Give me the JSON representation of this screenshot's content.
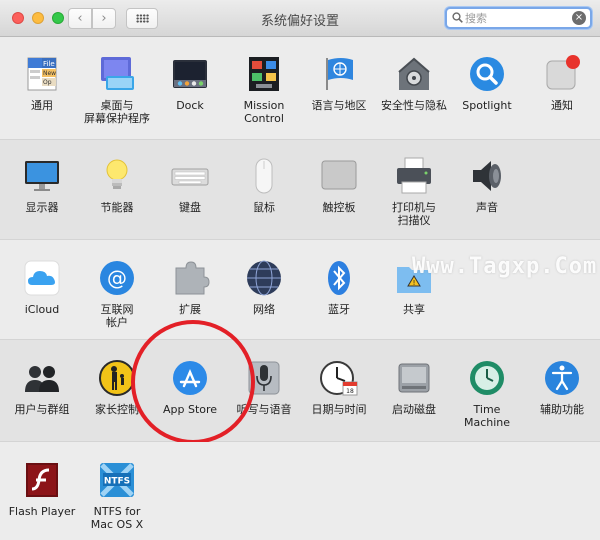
{
  "window": {
    "title": "系统偏好设置"
  },
  "toolbar": {
    "back_label": "‹",
    "forward_label": "›"
  },
  "search": {
    "placeholder": "搜索",
    "value": "",
    "clear_label": "×"
  },
  "watermark": "Www.Tagxp.Com",
  "sections": {
    "personal": [
      {
        "label": "通用",
        "icon": "general-icon"
      },
      {
        "label": "桌面与\n屏幕保护程序",
        "icon": "desktop-screensaver-icon"
      },
      {
        "label": "Dock",
        "icon": "dock-icon"
      },
      {
        "label": "Mission\nControl",
        "icon": "mission-control-icon"
      },
      {
        "label": "语言与地区",
        "icon": "language-region-icon"
      },
      {
        "label": "安全性与隐私",
        "icon": "security-privacy-icon"
      },
      {
        "label": "Spotlight",
        "icon": "spotlight-icon"
      },
      {
        "label": "通知",
        "icon": "notifications-icon"
      }
    ],
    "hardware": [
      {
        "label": "显示器",
        "icon": "displays-icon"
      },
      {
        "label": "节能器",
        "icon": "energy-saver-icon"
      },
      {
        "label": "键盘",
        "icon": "keyboard-icon"
      },
      {
        "label": "鼠标",
        "icon": "mouse-icon"
      },
      {
        "label": "触控板",
        "icon": "trackpad-icon"
      },
      {
        "label": "打印机与\n扫描仪",
        "icon": "printers-scanners-icon"
      },
      {
        "label": "声音",
        "icon": "sound-icon"
      }
    ],
    "internet": [
      {
        "label": "iCloud",
        "icon": "icloud-icon"
      },
      {
        "label": "互联网\n帐户",
        "icon": "internet-accounts-icon"
      },
      {
        "label": "扩展",
        "icon": "extensions-icon"
      },
      {
        "label": "网络",
        "icon": "network-icon"
      },
      {
        "label": "蓝牙",
        "icon": "bluetooth-icon"
      },
      {
        "label": "共享",
        "icon": "sharing-icon"
      }
    ],
    "system": [
      {
        "label": "用户与群组",
        "icon": "users-groups-icon"
      },
      {
        "label": "家长控制",
        "icon": "parental-controls-icon"
      },
      {
        "label": "App Store",
        "icon": "app-store-icon"
      },
      {
        "label": "听写与语音",
        "icon": "dictation-speech-icon"
      },
      {
        "label": "日期与时间",
        "icon": "date-time-icon"
      },
      {
        "label": "启动磁盘",
        "icon": "startup-disk-icon"
      },
      {
        "label": "Time Machine",
        "icon": "time-machine-icon"
      },
      {
        "label": "辅助功能",
        "icon": "accessibility-icon"
      }
    ],
    "other": [
      {
        "label": "Flash Player",
        "icon": "flash-player-icon"
      },
      {
        "label": "NTFS for\nMac OS X",
        "icon": "ntfs-icon"
      }
    ]
  }
}
